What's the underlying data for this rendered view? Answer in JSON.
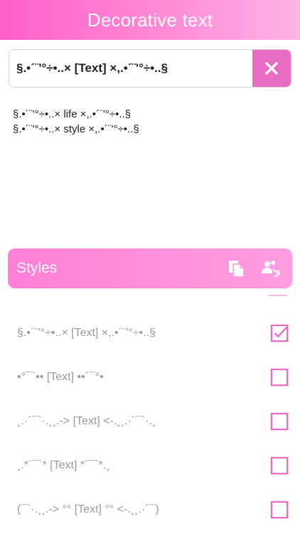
{
  "header": {
    "title": "Decorative text"
  },
  "input": {
    "value": "§.•´¨'°÷•..× [Text] ×,.•´¨'°÷•..§"
  },
  "clear_icon": "close-icon",
  "output": {
    "lines": [
      "§.•´¨'°÷•..× life ×,.•´¨'°÷•..§",
      "§.•´¨'°÷•..× style ×,.•´¨'°÷•..§"
    ]
  },
  "styles_bar": {
    "title": "Styles",
    "icons": [
      "copy-icon",
      "share-icon"
    ]
  },
  "accent": "#e86cc4",
  "styles": [
    {
      "text": "§.•´¨'°÷•..× [Text] ×,.•´¨'°÷•..§",
      "checked": true
    },
    {
      "text": "•°¯`•• [Text] ••´¯°•",
      "checked": false
    },
    {
      "text": "¸.·´¯`·.¸¸.-> [Text] <-.¸¸.·´¯`·.¸",
      "checked": false
    },
    {
      "text": "¸.*´¯`* [Text] *´¯`*.¸",
      "checked": false
    },
    {
      "text": "(¯`·.¸¸.-> °° [Text] °° <-.¸¸.·´¯)",
      "checked": false
    }
  ]
}
